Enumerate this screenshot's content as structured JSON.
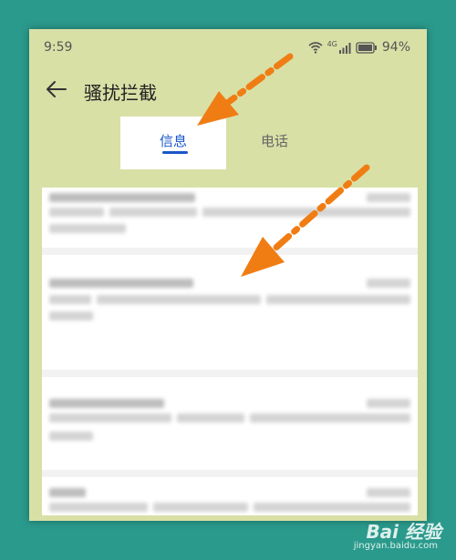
{
  "status_bar": {
    "time": "9:59",
    "battery": "94%",
    "network": "4G"
  },
  "header": {
    "title": "骚扰拦截"
  },
  "tabs": [
    {
      "label": "信息",
      "active": true
    },
    {
      "label": "电话",
      "active": false
    }
  ],
  "colors": {
    "accent": "#1a56c9",
    "annotation_arrow": "#f07d14",
    "background": "#2a9a8c",
    "panel": "#d8e0a6"
  },
  "watermark": {
    "brand": "Bai 经验",
    "url": "jingyan.baidu.com"
  }
}
